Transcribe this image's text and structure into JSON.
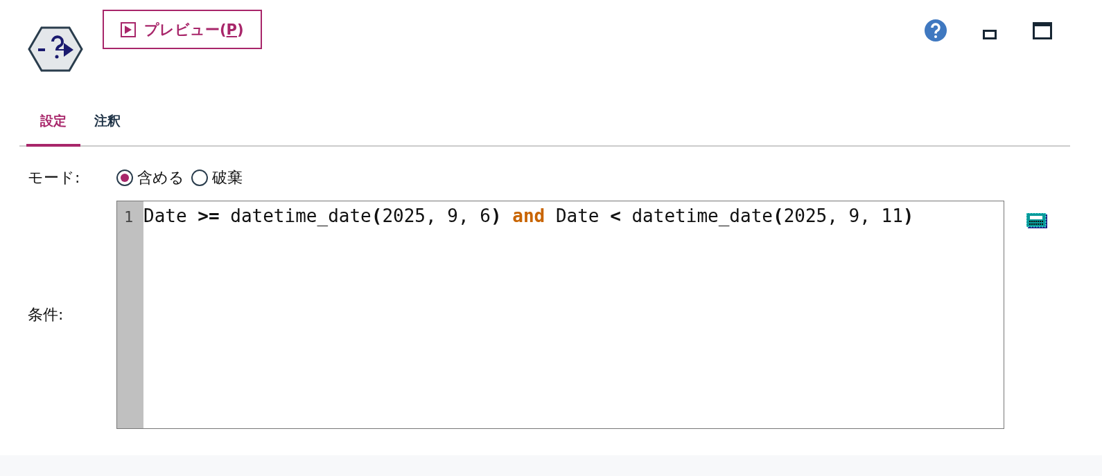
{
  "toolbar": {
    "preview_button": {
      "label_before": "プレビュー(",
      "mnemonic": "P",
      "label_after": ")"
    }
  },
  "tabs": [
    {
      "label": "設定",
      "selected": true
    },
    {
      "label": "注釈",
      "selected": false
    }
  ],
  "mode": {
    "label": "モード:",
    "options": [
      {
        "label": "含める",
        "selected": true
      },
      {
        "label": "破棄",
        "selected": false
      }
    ]
  },
  "condition": {
    "label": "条件:",
    "lines": [
      {
        "number": "1",
        "tokens": [
          {
            "kind": "plain",
            "text": "Date "
          },
          {
            "kind": "op",
            "text": ">="
          },
          {
            "kind": "plain",
            "text": " datetime_date"
          },
          {
            "kind": "op",
            "text": "("
          },
          {
            "kind": "plain",
            "text": "2025, 9, 6"
          },
          {
            "kind": "op",
            "text": ") "
          },
          {
            "kind": "keyword",
            "text": "and"
          },
          {
            "kind": "plain",
            "text": " Date "
          },
          {
            "kind": "op",
            "text": "<"
          },
          {
            "kind": "plain",
            "text": " datetime_date"
          },
          {
            "kind": "op",
            "text": "("
          },
          {
            "kind": "plain",
            "text": "2025, 9, 11"
          },
          {
            "kind": "op",
            "text": ")"
          }
        ]
      }
    ]
  }
}
